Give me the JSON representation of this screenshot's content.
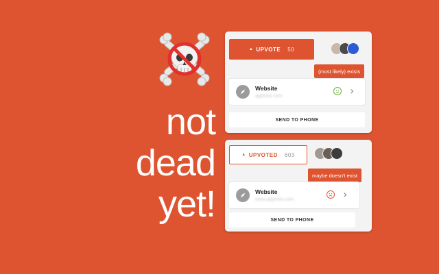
{
  "headline": {
    "line1": "not",
    "line2": "dead",
    "line3": "yet!"
  },
  "emoji": {
    "icon": "skull-crossbones-prohibited-icon"
  },
  "colors": {
    "background": "#de5430",
    "accent": "#de5430",
    "exists_face": "#6ab23a",
    "maybe_face": "#de5430"
  },
  "card_exists": {
    "upvote_label": "UPVOTE",
    "upvote_count": "50",
    "tooltip": "(most likely) exists",
    "site_title": "Website",
    "site_url": "appfolio.com",
    "status_icon": "smile-face-icon",
    "send_label": "SEND TO PHONE"
  },
  "card_maybe": {
    "upvote_label": "UPVOTED",
    "upvote_count": "603",
    "tooltip": "maybe doesn't exist",
    "site_title": "Website",
    "site_url": "www.appfolio.com",
    "status_icon": "frown-face-icon",
    "send_label": "SEND TO PHONE"
  }
}
